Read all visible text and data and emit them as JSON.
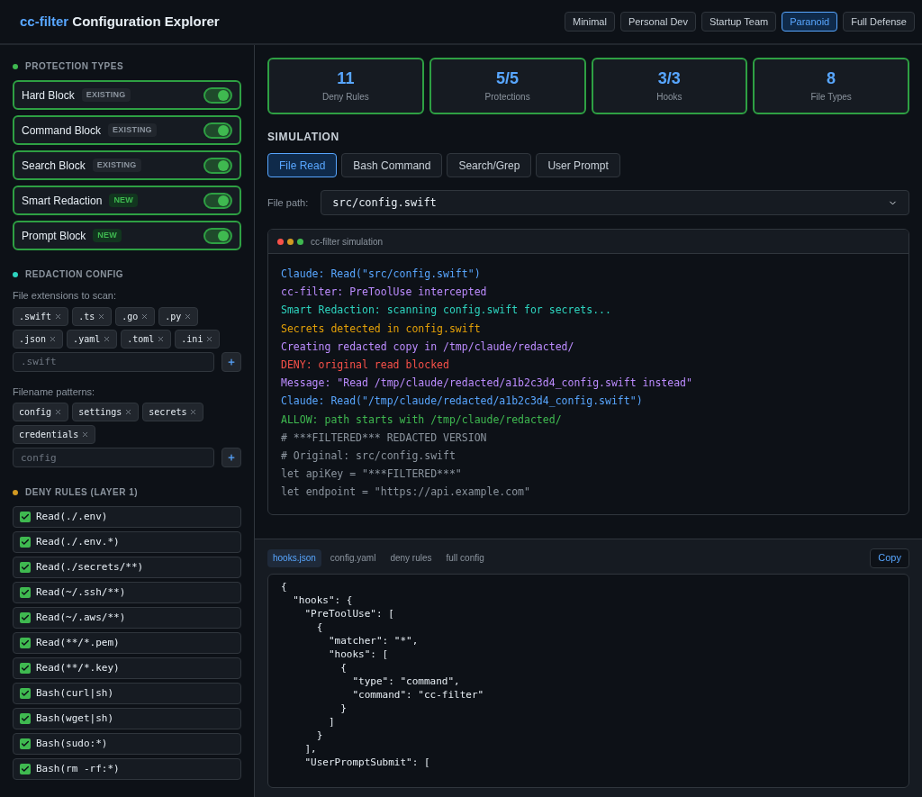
{
  "header": {
    "brand": "cc-filter",
    "title": "Configuration Explorer",
    "presets": [
      {
        "label": "Minimal",
        "selected": false
      },
      {
        "label": "Personal Dev",
        "selected": false
      },
      {
        "label": "Startup Team",
        "selected": false
      },
      {
        "label": "Paranoid",
        "selected": true
      },
      {
        "label": "Full Defense",
        "selected": false
      }
    ]
  },
  "sidebar": {
    "protection_types": {
      "title": "PROTECTION TYPES",
      "color": "#3fb950",
      "items": [
        {
          "name": "Hard Block",
          "badge": "EXISTING",
          "kind": "existing",
          "on": true
        },
        {
          "name": "Command Block",
          "badge": "EXISTING",
          "kind": "existing",
          "on": true
        },
        {
          "name": "Search Block",
          "badge": "EXISTING",
          "kind": "existing",
          "on": true
        },
        {
          "name": "Smart Redaction",
          "badge": "NEW",
          "kind": "new",
          "on": true
        },
        {
          "name": "Prompt Block",
          "badge": "NEW",
          "kind": "new",
          "on": true
        }
      ]
    },
    "redaction_config": {
      "title": "REDACTION CONFIG",
      "color": "#2dd4bf",
      "extensions": {
        "label": "File extensions to scan:",
        "tags": [
          ".swift",
          ".ts",
          ".go",
          ".py",
          ".json",
          ".yaml",
          ".toml",
          ".ini"
        ],
        "placeholder": ".swift"
      },
      "patterns": {
        "label": "Filename patterns:",
        "tags": [
          "config",
          "settings",
          "secrets",
          "credentials"
        ],
        "placeholder": "config"
      }
    },
    "deny_rules": {
      "title": "DENY RULES (LAYER 1)",
      "color": "#d29922",
      "rules": [
        {
          "rule": "Read(./.env)",
          "checked": true
        },
        {
          "rule": "Read(./.env.*)",
          "checked": true
        },
        {
          "rule": "Read(./secrets/**)",
          "checked": true
        },
        {
          "rule": "Read(~/.ssh/**)",
          "checked": true
        },
        {
          "rule": "Read(~/.aws/**)",
          "checked": true
        },
        {
          "rule": "Read(**/*.pem)",
          "checked": true
        },
        {
          "rule": "Read(**/*.key)",
          "checked": true
        },
        {
          "rule": "Bash(curl|sh)",
          "checked": true
        },
        {
          "rule": "Bash(wget|sh)",
          "checked": true
        },
        {
          "rule": "Bash(sudo:*)",
          "checked": true
        },
        {
          "rule": "Bash(rm -rf:*)",
          "checked": true
        }
      ]
    }
  },
  "stats": [
    {
      "value": "11",
      "label": "Deny Rules"
    },
    {
      "value": "5/5",
      "label": "Protections"
    },
    {
      "value": "3/3",
      "label": "Hooks"
    },
    {
      "value": "8",
      "label": "File Types"
    }
  ],
  "simulation": {
    "title": "SIMULATION",
    "tabs": [
      {
        "label": "File Read",
        "selected": true
      },
      {
        "label": "Bash Command",
        "selected": false
      },
      {
        "label": "Search/Grep",
        "selected": false
      },
      {
        "label": "User Prompt",
        "selected": false
      }
    ],
    "file_path": {
      "label": "File path:",
      "value": "src/config.swift"
    },
    "terminal": {
      "title": "cc-filter simulation",
      "lines": [
        {
          "text": "Claude: Read(\"src/config.swift\")",
          "color": "#58a6ff"
        },
        {
          "text": "cc-filter: PreToolUse intercepted",
          "color": "#bc8cff"
        },
        {
          "text": "Smart Redaction: scanning config.swift for secrets...",
          "color": "#2dd4bf"
        },
        {
          "text": "Secrets detected in config.swift",
          "color": "#e3a008"
        },
        {
          "text": "Creating redacted copy in /tmp/claude/redacted/",
          "color": "#bc8cff"
        },
        {
          "text": "DENY: original read blocked",
          "color": "#f85149"
        },
        {
          "text": "Message: \"Read /tmp/claude/redacted/a1b2c3d4_config.swift instead\"",
          "color": "#bc8cff"
        },
        {
          "text": "Claude: Read(\"/tmp/claude/redacted/a1b2c3d4_config.swift\")",
          "color": "#58a6ff"
        },
        {
          "text": "ALLOW: path starts with /tmp/claude/redacted/",
          "color": "#3fb950"
        },
        {
          "text": "# ***FILTERED*** REDACTED VERSION",
          "color": "#8b949e"
        },
        {
          "text": "# Original: src/config.swift",
          "color": "#8b949e"
        },
        {
          "text": "let apiKey = \"***FILTERED***\"",
          "color": "#8b949e"
        },
        {
          "text": "let endpoint = \"https://api.example.com\"",
          "color": "#8b949e"
        }
      ]
    }
  },
  "output": {
    "tabs": [
      {
        "label": "hooks.json",
        "selected": true
      },
      {
        "label": "config.yaml",
        "selected": false
      },
      {
        "label": "deny rules",
        "selected": false
      },
      {
        "label": "full config",
        "selected": false
      }
    ],
    "copy": "Copy",
    "code": [
      "{",
      "  \"hooks\": {",
      "    \"PreToolUse\": [",
      "      {",
      "        \"matcher\": \"*\",",
      "        \"hooks\": [",
      "          {",
      "            \"type\": \"command\",",
      "            \"command\": \"cc-filter\"",
      "          }",
      "        ]",
      "      }",
      "    ],",
      "    \"UserPromptSubmit\": ["
    ]
  }
}
